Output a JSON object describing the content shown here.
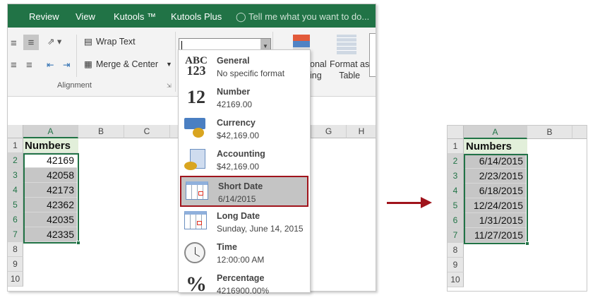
{
  "ribbon": {
    "tabs": [
      "Review",
      "View",
      "Kutools ™",
      "Kutools Plus"
    ],
    "tell_me": "Tell me what you want to do...",
    "wrap_text": "Wrap Text",
    "merge_center": "Merge & Center",
    "group_label": "Alignment",
    "conditional_formatting": [
      "onal",
      "ing"
    ],
    "format_as_table": [
      "Format as",
      "Table"
    ],
    "number_format_value": ""
  },
  "format_menu": [
    {
      "title": "General",
      "sample": "No specific format",
      "icon": "abc-123-icon"
    },
    {
      "title": "Number",
      "sample": "42169.00",
      "icon": "number-12-icon"
    },
    {
      "title": "Currency",
      "sample": "$42,169.00",
      "icon": "currency-icon"
    },
    {
      "title": "Accounting",
      "sample": " $42,169.00",
      "icon": "accounting-icon"
    },
    {
      "title": "Short Date",
      "sample": "6/14/2015",
      "icon": "calendar-icon",
      "selected": true
    },
    {
      "title": "Long Date",
      "sample": "Sunday, June 14, 2015",
      "icon": "calendar-icon"
    },
    {
      "title": "Time",
      "sample": "12:00:00 AM",
      "icon": "clock-icon"
    },
    {
      "title": "Percentage",
      "sample": "4216900.00%",
      "icon": "percent-icon"
    }
  ],
  "left_sheet": {
    "columns": [
      "A",
      "B",
      "C",
      "G",
      "H"
    ],
    "rows": [
      "1",
      "2",
      "3",
      "4",
      "5",
      "6",
      "7",
      "8",
      "9",
      "10"
    ],
    "header": "Numbers",
    "values": [
      "42169",
      "42058",
      "42173",
      "42362",
      "42035",
      "42335"
    ]
  },
  "right_sheet": {
    "columns": [
      "A",
      "B"
    ],
    "rows": [
      "1",
      "2",
      "3",
      "4",
      "5",
      "6",
      "7",
      "8",
      "9",
      "10"
    ],
    "header": "Numbers",
    "values": [
      "6/14/2015",
      "2/23/2015",
      "6/18/2015",
      "12/24/2015",
      "1/31/2015",
      "11/27/2015"
    ]
  },
  "colors": {
    "excel_green": "#217346",
    "highlight_red": "#a0141c",
    "arrow": "#a0141c"
  }
}
